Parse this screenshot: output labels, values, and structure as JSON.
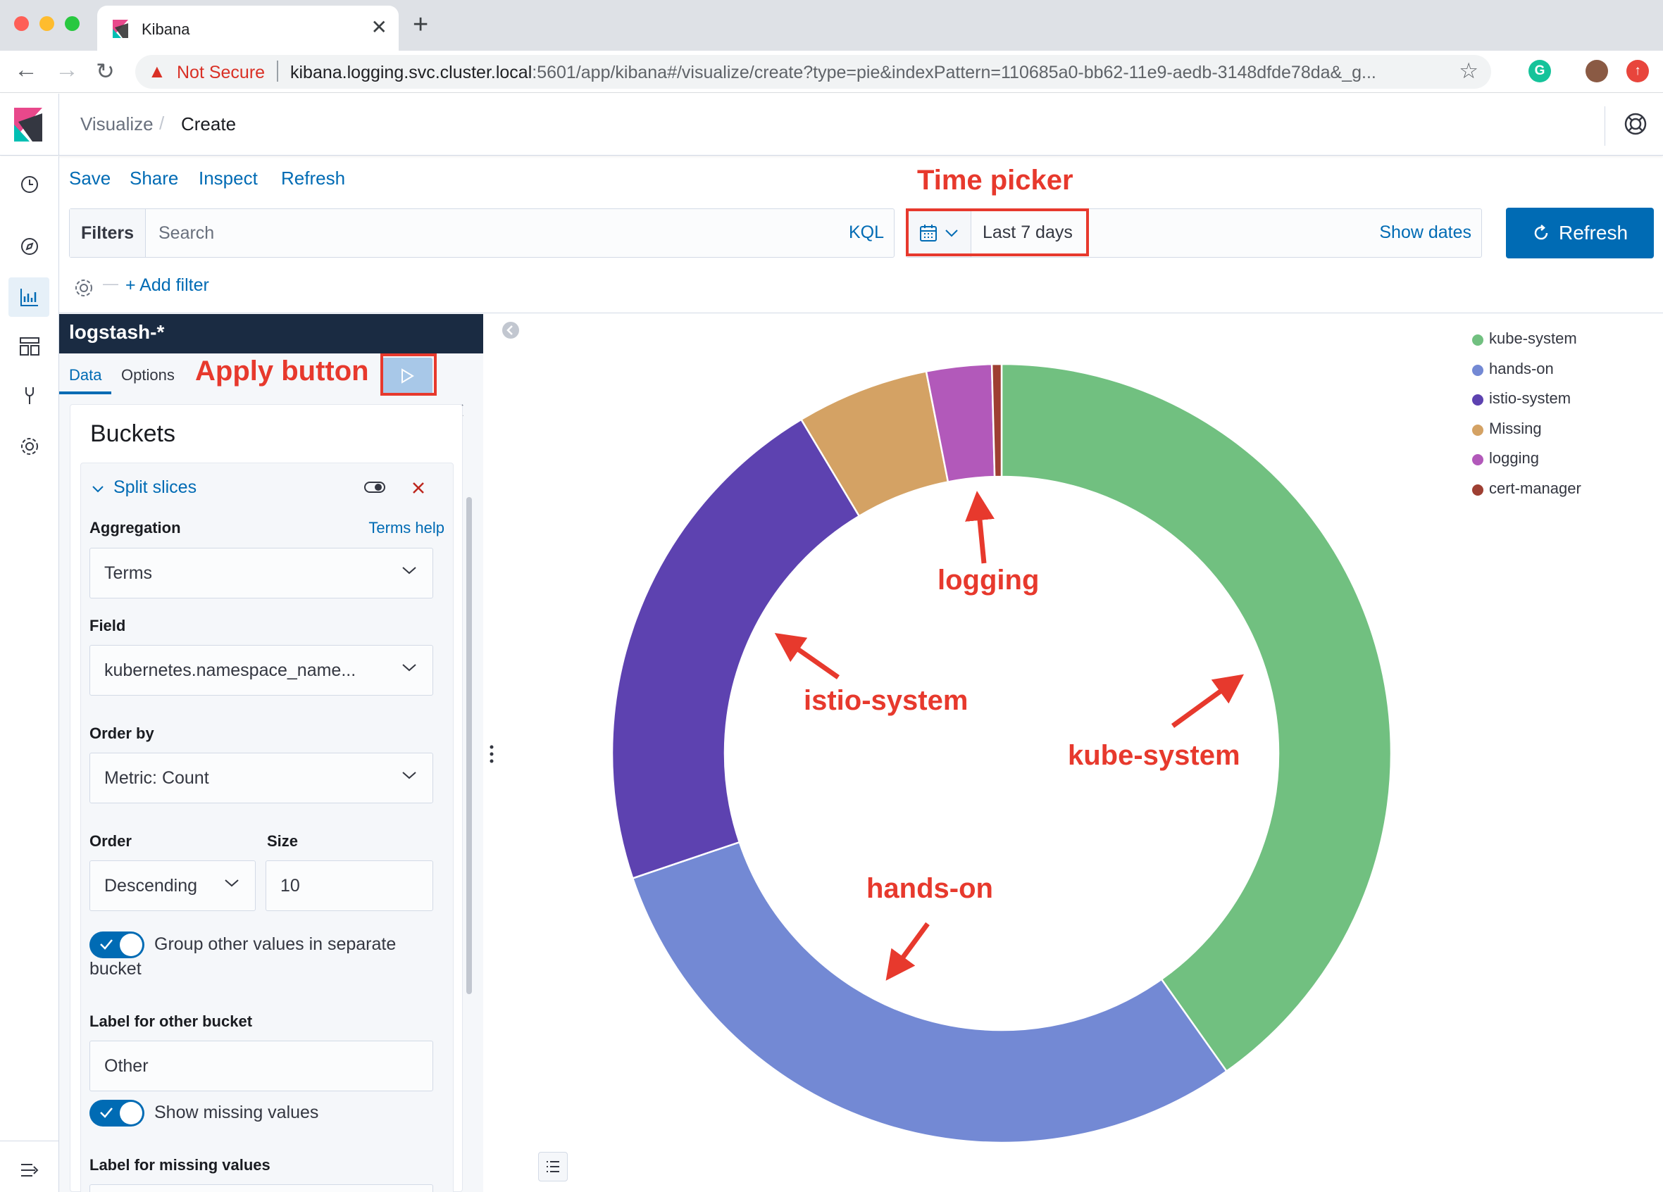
{
  "browser": {
    "tab_title": "Kibana",
    "security_label": "Not Secure",
    "url_host": "kibana.logging.svc.cluster.local",
    "url_rest": ":5601/app/kibana#/visualize/create?type=pie&indexPattern=110685a0-bb62-11e9-aedb-3148dfde78da&_g..."
  },
  "header": {
    "breadcrumbs": [
      "Visualize",
      "/",
      "Create"
    ]
  },
  "top_menu": [
    "Save",
    "Share",
    "Inspect",
    "Refresh"
  ],
  "query_bar": {
    "filters_label": "Filters",
    "search_placeholder": "Search",
    "kql_label": "KQL",
    "add_filter_label": "+ Add filter"
  },
  "time_picker": {
    "range_label": "Last 7 days",
    "show_dates_label": "Show dates",
    "refresh_label": "Refresh"
  },
  "editor": {
    "index_pattern": "logstash-*",
    "tabs": [
      "Data",
      "Options"
    ],
    "buckets_title": "Buckets",
    "split_title": "Split slices",
    "aggregation": {
      "label": "Aggregation",
      "help_link": "Terms help",
      "value": "Terms"
    },
    "field": {
      "label": "Field",
      "value": "kubernetes.namespace_name..."
    },
    "order_by": {
      "label": "Order by",
      "value": "Metric: Count"
    },
    "order": {
      "label": "Order",
      "value": "Descending"
    },
    "size": {
      "label": "Size",
      "value": "10"
    },
    "group_other": {
      "label_line1": "Group other values in separate",
      "label_line2": "bucket",
      "enabled": true
    },
    "other_bucket_label": {
      "label": "Label for other bucket",
      "value": "Other"
    },
    "show_missing": {
      "label": "Show missing values",
      "enabled": true
    },
    "missing_bucket_label": {
      "label": "Label for missing values"
    }
  },
  "annotations": {
    "time_picker": "Time picker",
    "apply_button": "Apply button",
    "logging": "logging",
    "istio_system": "istio-system",
    "kube_system": "kube-system",
    "hands_on": "hands-on"
  },
  "chart_data": {
    "type": "pie",
    "donut": true,
    "categories": [
      "kube-system",
      "hands-on",
      "istio-system",
      "Missing",
      "logging",
      "cert-manager"
    ],
    "values": [
      40.2,
      29.6,
      21.6,
      5.5,
      2.7,
      0.4
    ],
    "colors": [
      "#71c080",
      "#7389d4",
      "#5d42b0",
      "#d4a264",
      "#b259ba",
      "#9e3f32"
    ],
    "legend_position": "top-right"
  }
}
